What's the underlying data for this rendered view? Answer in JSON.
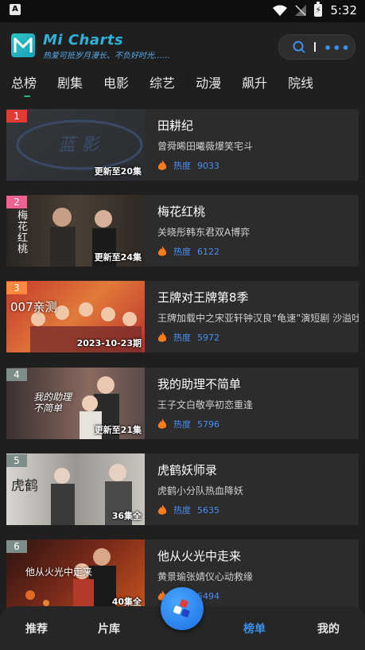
{
  "status_bar": {
    "left_icon_letter": "A",
    "time": "5:32"
  },
  "header": {
    "app_title": "Mi Charts",
    "slogan": "热爱可抵岁月漫长、不负好时光……"
  },
  "tabs": [
    "总榜",
    "剧集",
    "电影",
    "综艺",
    "动漫",
    "飙升",
    "院线"
  ],
  "active_tab": "总榜",
  "heat_label": "热度",
  "items": [
    {
      "rank": "1",
      "title": "田耕纪",
      "desc": "曾舜晞田曦薇爆笑宅斗",
      "heat": "9033",
      "update": "更新至20集",
      "rank_color": "#e53935",
      "thumb_text": ""
    },
    {
      "rank": "2",
      "title": "梅花红桃",
      "desc": "关晓彤韩东君双A博弈",
      "heat": "6122",
      "update": "更新至24集",
      "rank_color": "#f06292",
      "thumb_text": "梅花红桃"
    },
    {
      "rank": "3",
      "title": "王牌对王牌第8季",
      "desc": "王牌加载中之宋亚轩钟汉良“龟速”演短剧 沙溢吐槽",
      "heat": "5972",
      "update": "2023-10-23期",
      "rank_color": "#ff8a3d",
      "thumb_text": "007亲测"
    },
    {
      "rank": "4",
      "title": "我的助理不简单",
      "desc": "王子文白敬亭初恋重逢",
      "heat": "5796",
      "update": "更新至21集",
      "rank_color": "#7d8e8a",
      "thumb_text": "我的助理不简单"
    },
    {
      "rank": "5",
      "title": "虎鹤妖师录",
      "desc": "虎鹤小分队热血降妖",
      "heat": "5635",
      "update": "36集全",
      "rank_color": "#7d8e8a",
      "thumb_text": "虎鹤"
    },
    {
      "rank": "6",
      "title": "他从火光中走来",
      "desc": "黄景瑜张婧仪心动救缘",
      "heat": "5494",
      "update": "40集全",
      "rank_color": "#7d8e8a",
      "thumb_text": "他从火光中走来"
    }
  ],
  "bottom_nav": [
    "推荐",
    "片库",
    "榜单",
    "我的"
  ],
  "active_nav": "榜单",
  "colors": {
    "accent": "#3d8fe6",
    "background": "#1f1f1f",
    "card": "#2c2c2c"
  }
}
